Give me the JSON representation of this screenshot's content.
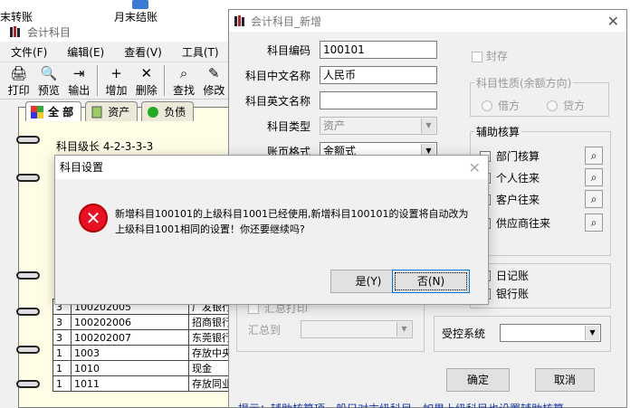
{
  "desktop": {
    "labels": [
      "末转账",
      "月末结账"
    ]
  },
  "bg_window": {
    "title": "会计科目",
    "menu": [
      "文件(F)",
      "编辑(E)",
      "查看(V)",
      "工具(T)"
    ],
    "toolbar": [
      {
        "label": "打印",
        "icon": "printer-icon",
        "glyph": "🖨"
      },
      {
        "label": "预览",
        "icon": "preview-icon",
        "glyph": "🔍"
      },
      {
        "label": "输出",
        "icon": "export-icon",
        "glyph": "⇥"
      },
      {
        "label": "增加",
        "icon": "add-icon",
        "glyph": "+"
      },
      {
        "label": "删除",
        "icon": "delete-icon",
        "glyph": "✕"
      },
      {
        "label": "查找",
        "icon": "find-icon",
        "glyph": "⌕"
      },
      {
        "label": "修改",
        "icon": "edit-icon",
        "glyph": "✎"
      }
    ],
    "tabs": [
      "全 部",
      "资产",
      "负债"
    ],
    "level_label": "科目级长  4-2-3-3-3",
    "rows": [
      {
        "level": "3",
        "code": "100202005",
        "name": "广发银行"
      },
      {
        "level": "3",
        "code": "100202006",
        "name": "招商银行"
      },
      {
        "level": "3",
        "code": "100202007",
        "name": "东莞银行"
      },
      {
        "level": "1",
        "code": "1003",
        "name": "存放中央银行"
      },
      {
        "level": "1",
        "code": "1010",
        "name": "现金"
      },
      {
        "level": "1",
        "code": "1011",
        "name": "存放同业"
      }
    ]
  },
  "dialog": {
    "title": "会计科目_新增",
    "fields": {
      "code_label": "科目编码",
      "code_value": "100101",
      "cn_name_label": "科目中文名称",
      "cn_name_value": "人民币",
      "en_name_label": "科目英文名称",
      "en_name_value": "",
      "type_label": "科目类型",
      "type_value": "资产",
      "format_label": "账页格式",
      "format_value": "金额式"
    },
    "sealed_label": "封存",
    "nature": {
      "legend": "科目性质(余额方向)",
      "debit": "借方",
      "credit": "贷方"
    },
    "aux": {
      "legend": "辅助核算",
      "items": [
        "部门核算",
        "个人往来",
        "客户往来",
        "供应商往来"
      ]
    },
    "journal_label": "日记账",
    "bank_label": "银行账",
    "summary_print_label": "汇总打印",
    "summary_to_label": "汇总到",
    "controlled_label": "受控系统",
    "ok": "确定",
    "cancel": "取消",
    "hint": "提示：辅助核算项一般只对末级科目，如果上级科目也设置辅助核算，"
  },
  "messagebox": {
    "title": "科目设置",
    "message": "新增科目100101的上级科目1001已经使用,新增科目100101的设置将自动改为上级科目1001相同的设置！你还要继续吗?",
    "yes": "是(Y)",
    "no": "否(N)"
  }
}
